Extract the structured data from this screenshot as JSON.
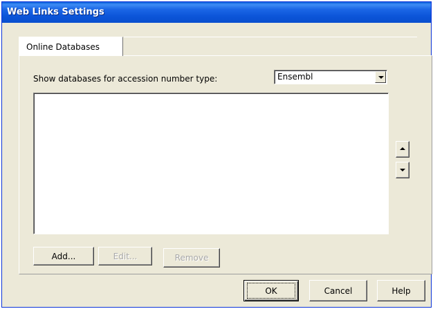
{
  "window": {
    "title": "Web Links Settings"
  },
  "tabs": [
    {
      "label": "Online Databases",
      "selected": true
    }
  ],
  "panel": {
    "show_label": "Show databases for accession number type:",
    "accession_type": {
      "selected": "Ensembl"
    },
    "database_list": {
      "items": []
    },
    "side_buttons": {
      "up_icon": "arrow-up-icon",
      "down_icon": "arrow-down-icon"
    },
    "buttons": {
      "add_label": "Add...",
      "edit_label": "Edit...",
      "remove_label": "Remove"
    }
  },
  "footer": {
    "ok_label": "OK",
    "cancel_label": "Cancel",
    "help_label": "Help"
  },
  "colors": {
    "titlebar": "#0a54d8",
    "dialog_bg": "#ece9d8",
    "disabled_text": "#a9a9a9"
  }
}
